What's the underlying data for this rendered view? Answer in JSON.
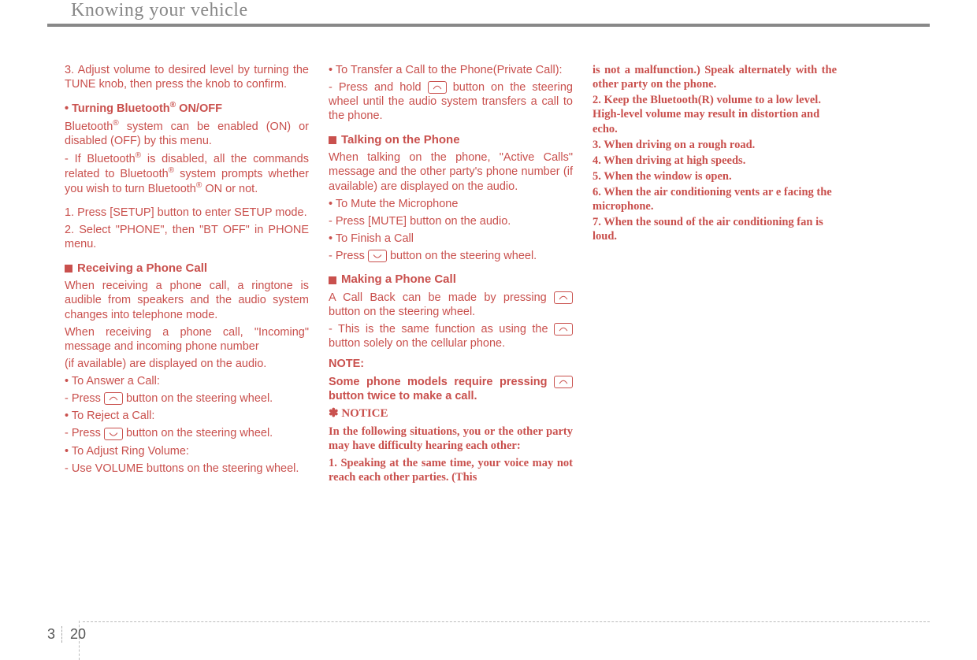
{
  "header": {
    "section_title": "Knowing your vehicle"
  },
  "footer": {
    "chapter": "3",
    "page": "20"
  },
  "col1": {
    "p1": "3. Adjust volume  to desired level by turning the TUNE knob, then press the knob to confirm.",
    "h1a": "• Turning Bluetooth",
    "h1b": " ON/OFF",
    "p2a": "Bluetooth",
    "p2b": " system can be enabled (ON) or disabled (OFF) by this menu.",
    "p3a": "- If Bluetooth",
    "p3b": " is disabled, all the commands related to Bluetooth",
    "p3c": " system prompts whether you wish to turn Bluetooth",
    "p3d": " ON or not.",
    "p4": "1. Press [SETUP] button to enter SETUP mode.",
    "p5": "2. Select \"PHONE\", then \"BT OFF\" in PHONE menu.",
    "sect1": "Receiving a Phone Call",
    "p6": "When receiving a phone call, a ringtone is audible from speakers and the audio system changes into telephone mode.",
    "p7": "When receiving a phone call, \"Incoming\" message and incoming phone number",
    "p8": "(if available) are displayed on the audio.",
    "p9": "• To Answer a Call:",
    "p10a": "- Press ",
    "p10b": " button on the steering wheel.",
    "p11": "• To Reject a Call:",
    "p12a": "- Press ",
    "p12b": " button on the steering wheel.",
    "p13": "• To Adjust Ring Volume:",
    "p14": "- Use VOLUME buttons on the steering wheel."
  },
  "col2": {
    "p1": "• To Transfer a Call to the Phone(Private Call):",
    "p2a": "- Press and hold ",
    "p2b": " button on the steering wheel until the audio system transfers a call to the phone.",
    "sect1": "Talking on the Phone",
    "p3": "When talking on the phone, \"Active Calls\" message and the other party's phone number (if available) are displayed on the audio.",
    "p4": "• To Mute the Microphone",
    "p5": "- Press [MUTE] button on the audio.",
    "p6": "• To Finish a Call",
    "p7a": "- Press ",
    "p7b": " button on the steering wheel.",
    "sect2": "Making a Phone Call",
    "p8a": "A Call Back can be made by pressing ",
    "p8b": " button on the steering  wheel.",
    "p9a": "- This is the same function as using the ",
    "p9b": " button solely on the cellular phone.",
    "note_hd": "NOTE:",
    "note_b1": "Some phone models require pressing ",
    "note_b2": " button twice to make a call.",
    "notice_hd": "✽ NOTICE",
    "n1": "In the following situations, you or      the other party may have difficulty hearing each other:",
    "n2": "1. Speaking at the same time, your   voice may not reach each other parties. (This"
  },
  "col3": {
    "p0": "is not a malfunction.) Speak alternately with the other party on the phone.",
    "p1": "2. Keep the Bluetooth(R) volume to a low level. High-level volume may result in distortion and echo.",
    "p2": "3. When driving on a rough road.",
    "p3": "4. When driving at high speeds.",
    "p4": "5. When the window is open.",
    "p5": "6. When the air   conditioning vents ar e facing the microphone.",
    "p6": "7. When the sound of the air   conditioning fan is loud."
  },
  "sup": {
    "reg": "®"
  }
}
